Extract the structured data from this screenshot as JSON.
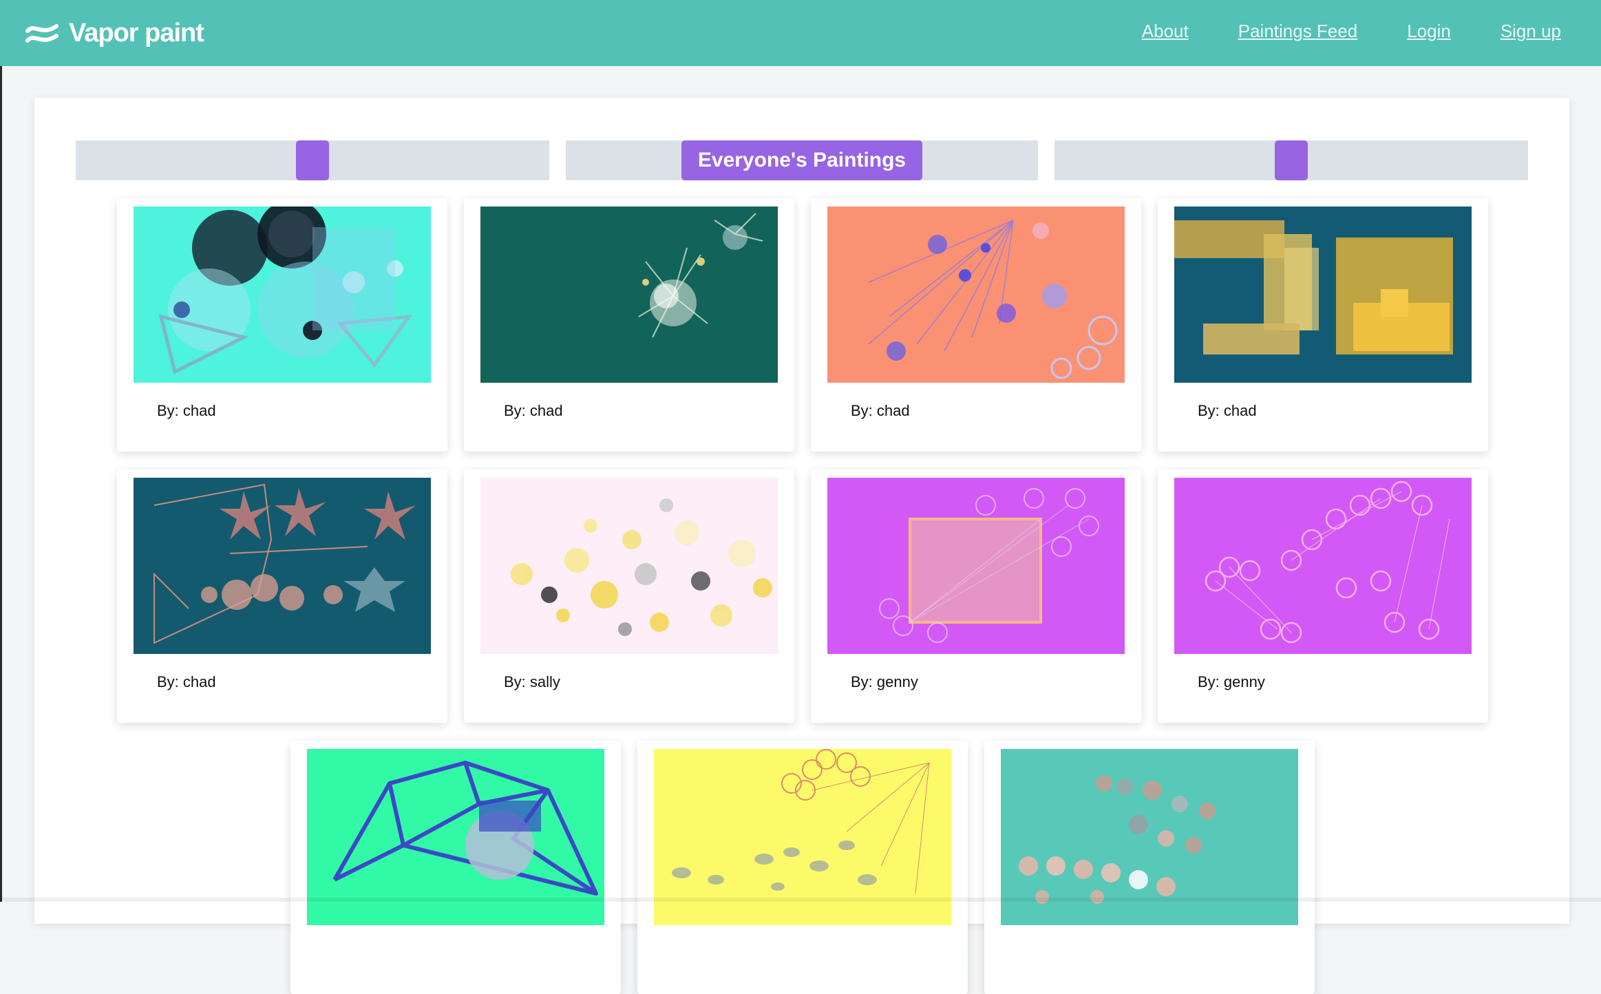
{
  "app": {
    "brand": "Vapor paint",
    "nav": [
      {
        "label": "About"
      },
      {
        "label": "Paintings Feed"
      },
      {
        "label": "Login"
      },
      {
        "label": "Sign up"
      }
    ]
  },
  "feed": {
    "title": "Everyone's Paintings",
    "accent_color": "#9764e3",
    "paintings": [
      {
        "author_label": "By: chad",
        "bg": "#4df3dd"
      },
      {
        "author_label": "By: chad",
        "bg": "#12635a"
      },
      {
        "author_label": "By: chad",
        "bg": "#fb9173"
      },
      {
        "author_label": "By: chad",
        "bg": "#135a75"
      },
      {
        "author_label": "By: chad",
        "bg": "#135a6e"
      },
      {
        "author_label": "By: sally",
        "bg": "#fdeef7"
      },
      {
        "author_label": "By: genny",
        "bg": "#d259f5"
      },
      {
        "author_label": "By: genny",
        "bg": "#d259f5"
      },
      {
        "author_label": "",
        "bg": "#32f9a6"
      },
      {
        "author_label": "",
        "bg": "#fdfa6a"
      },
      {
        "author_label": "",
        "bg": "#58c8b9"
      }
    ]
  }
}
